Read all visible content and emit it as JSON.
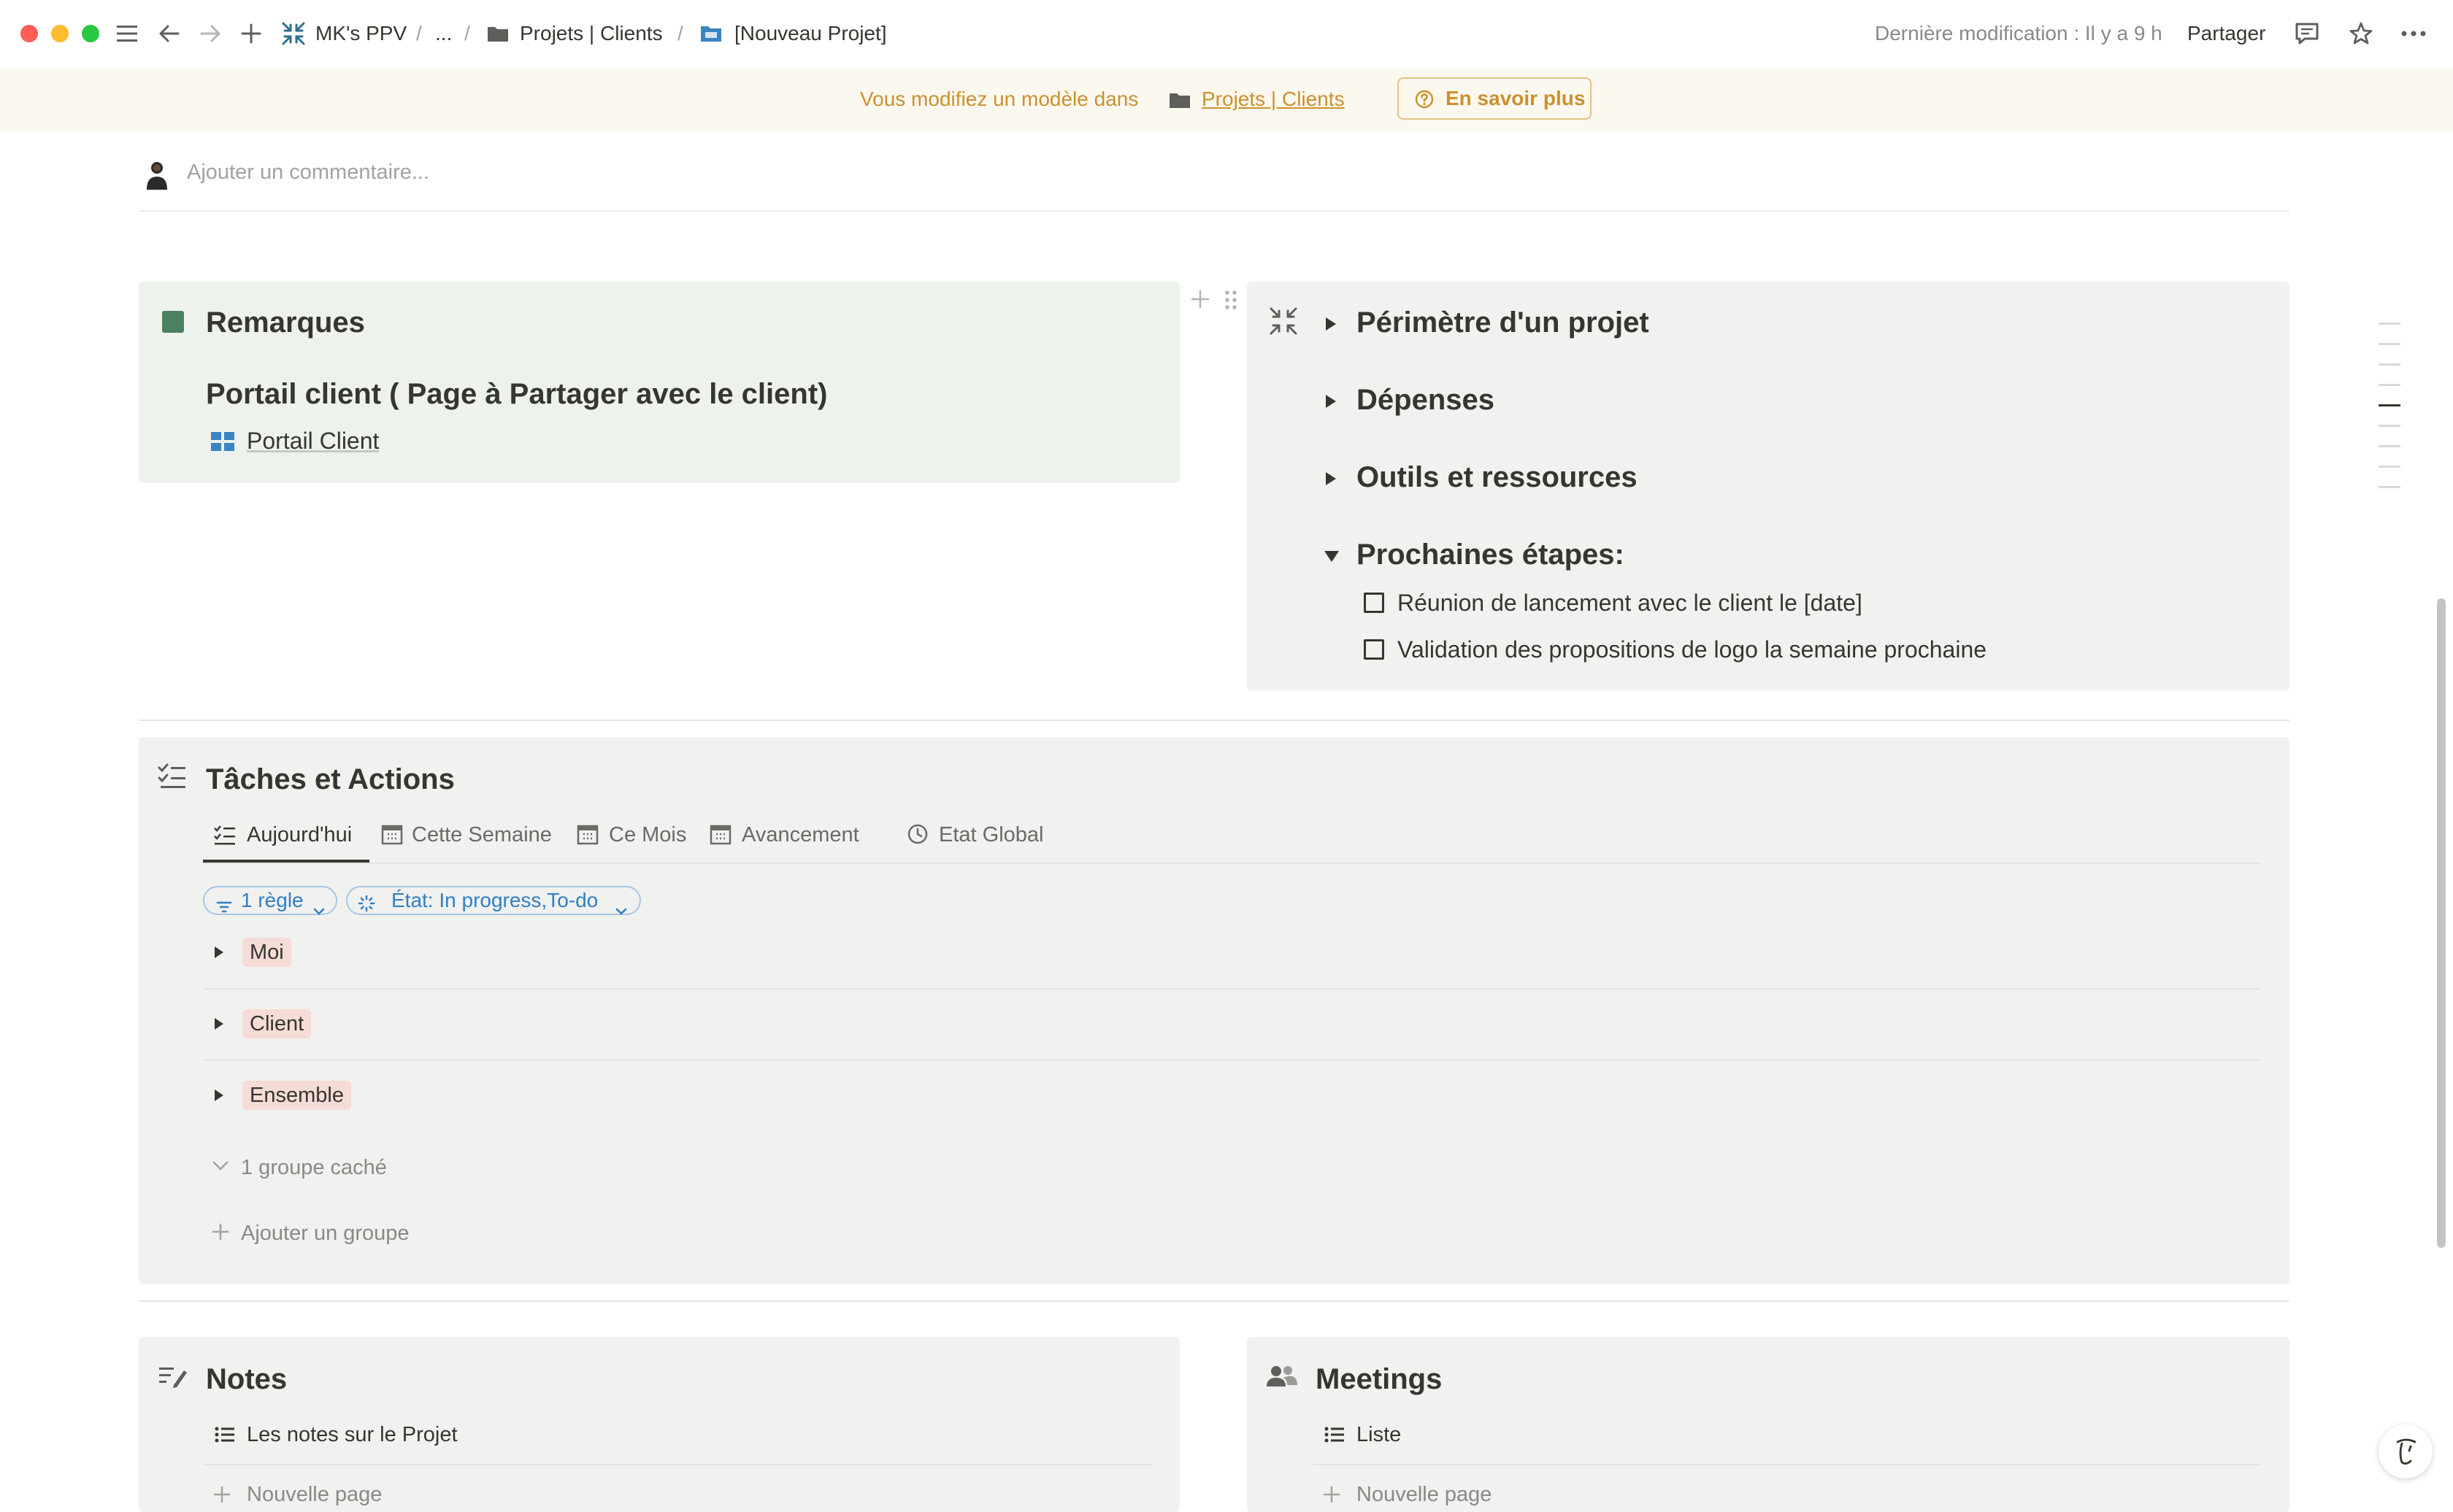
{
  "topbar": {
    "workspace": "MK's PPV",
    "ellipsis": "...",
    "breadcrumb_folder": "Projets | Clients",
    "breadcrumb_page": "[Nouveau Projet]",
    "last_modified": "Dernière modification : Il y a 9 h",
    "share": "Partager",
    "colors": {
      "close": "#ff5f57",
      "minimize": "#febc2e",
      "maximize": "#28c840"
    }
  },
  "banner": {
    "message": "Vous modifiez un modèle dans",
    "folder": "Projets | Clients",
    "learn_more": "En savoir plus"
  },
  "comment": {
    "placeholder": "Ajouter un commentaire..."
  },
  "remarques": {
    "title": "Remarques",
    "subheading": "Portail client ( Page à Partager avec le client)",
    "link": "Portail Client",
    "accent_color": "#4b8061"
  },
  "toggles": {
    "perimetre": "Périmètre d'un projet",
    "depenses": "Dépenses",
    "outils": "Outils et ressources",
    "prochaines": "Prochaines étapes:",
    "todos": [
      {
        "label": "Réunion de lancement avec le client le [date]",
        "checked": false
      },
      {
        "label": "Validation des propositions de logo la semaine prochaine",
        "checked": false
      }
    ]
  },
  "taches": {
    "title": "Tâches et Actions",
    "tabs": [
      "Aujourd'hui",
      "Cette Semaine",
      "Ce Mois",
      "Avancement",
      "Etat Global"
    ],
    "active_tab": "Aujourd'hui",
    "filter_rule": "1 règle",
    "filter_state": "État: In progress,To-do",
    "groups": [
      "Moi",
      "Client",
      "Ensemble"
    ],
    "hidden_groups": "1 groupe caché",
    "add_group": "Ajouter un groupe"
  },
  "notes": {
    "title": "Notes",
    "view": "Les notes sur le Projet",
    "new_page": "Nouvelle page"
  },
  "meetings": {
    "title": "Meetings",
    "view": "Liste",
    "new_page": "Nouvelle page"
  }
}
